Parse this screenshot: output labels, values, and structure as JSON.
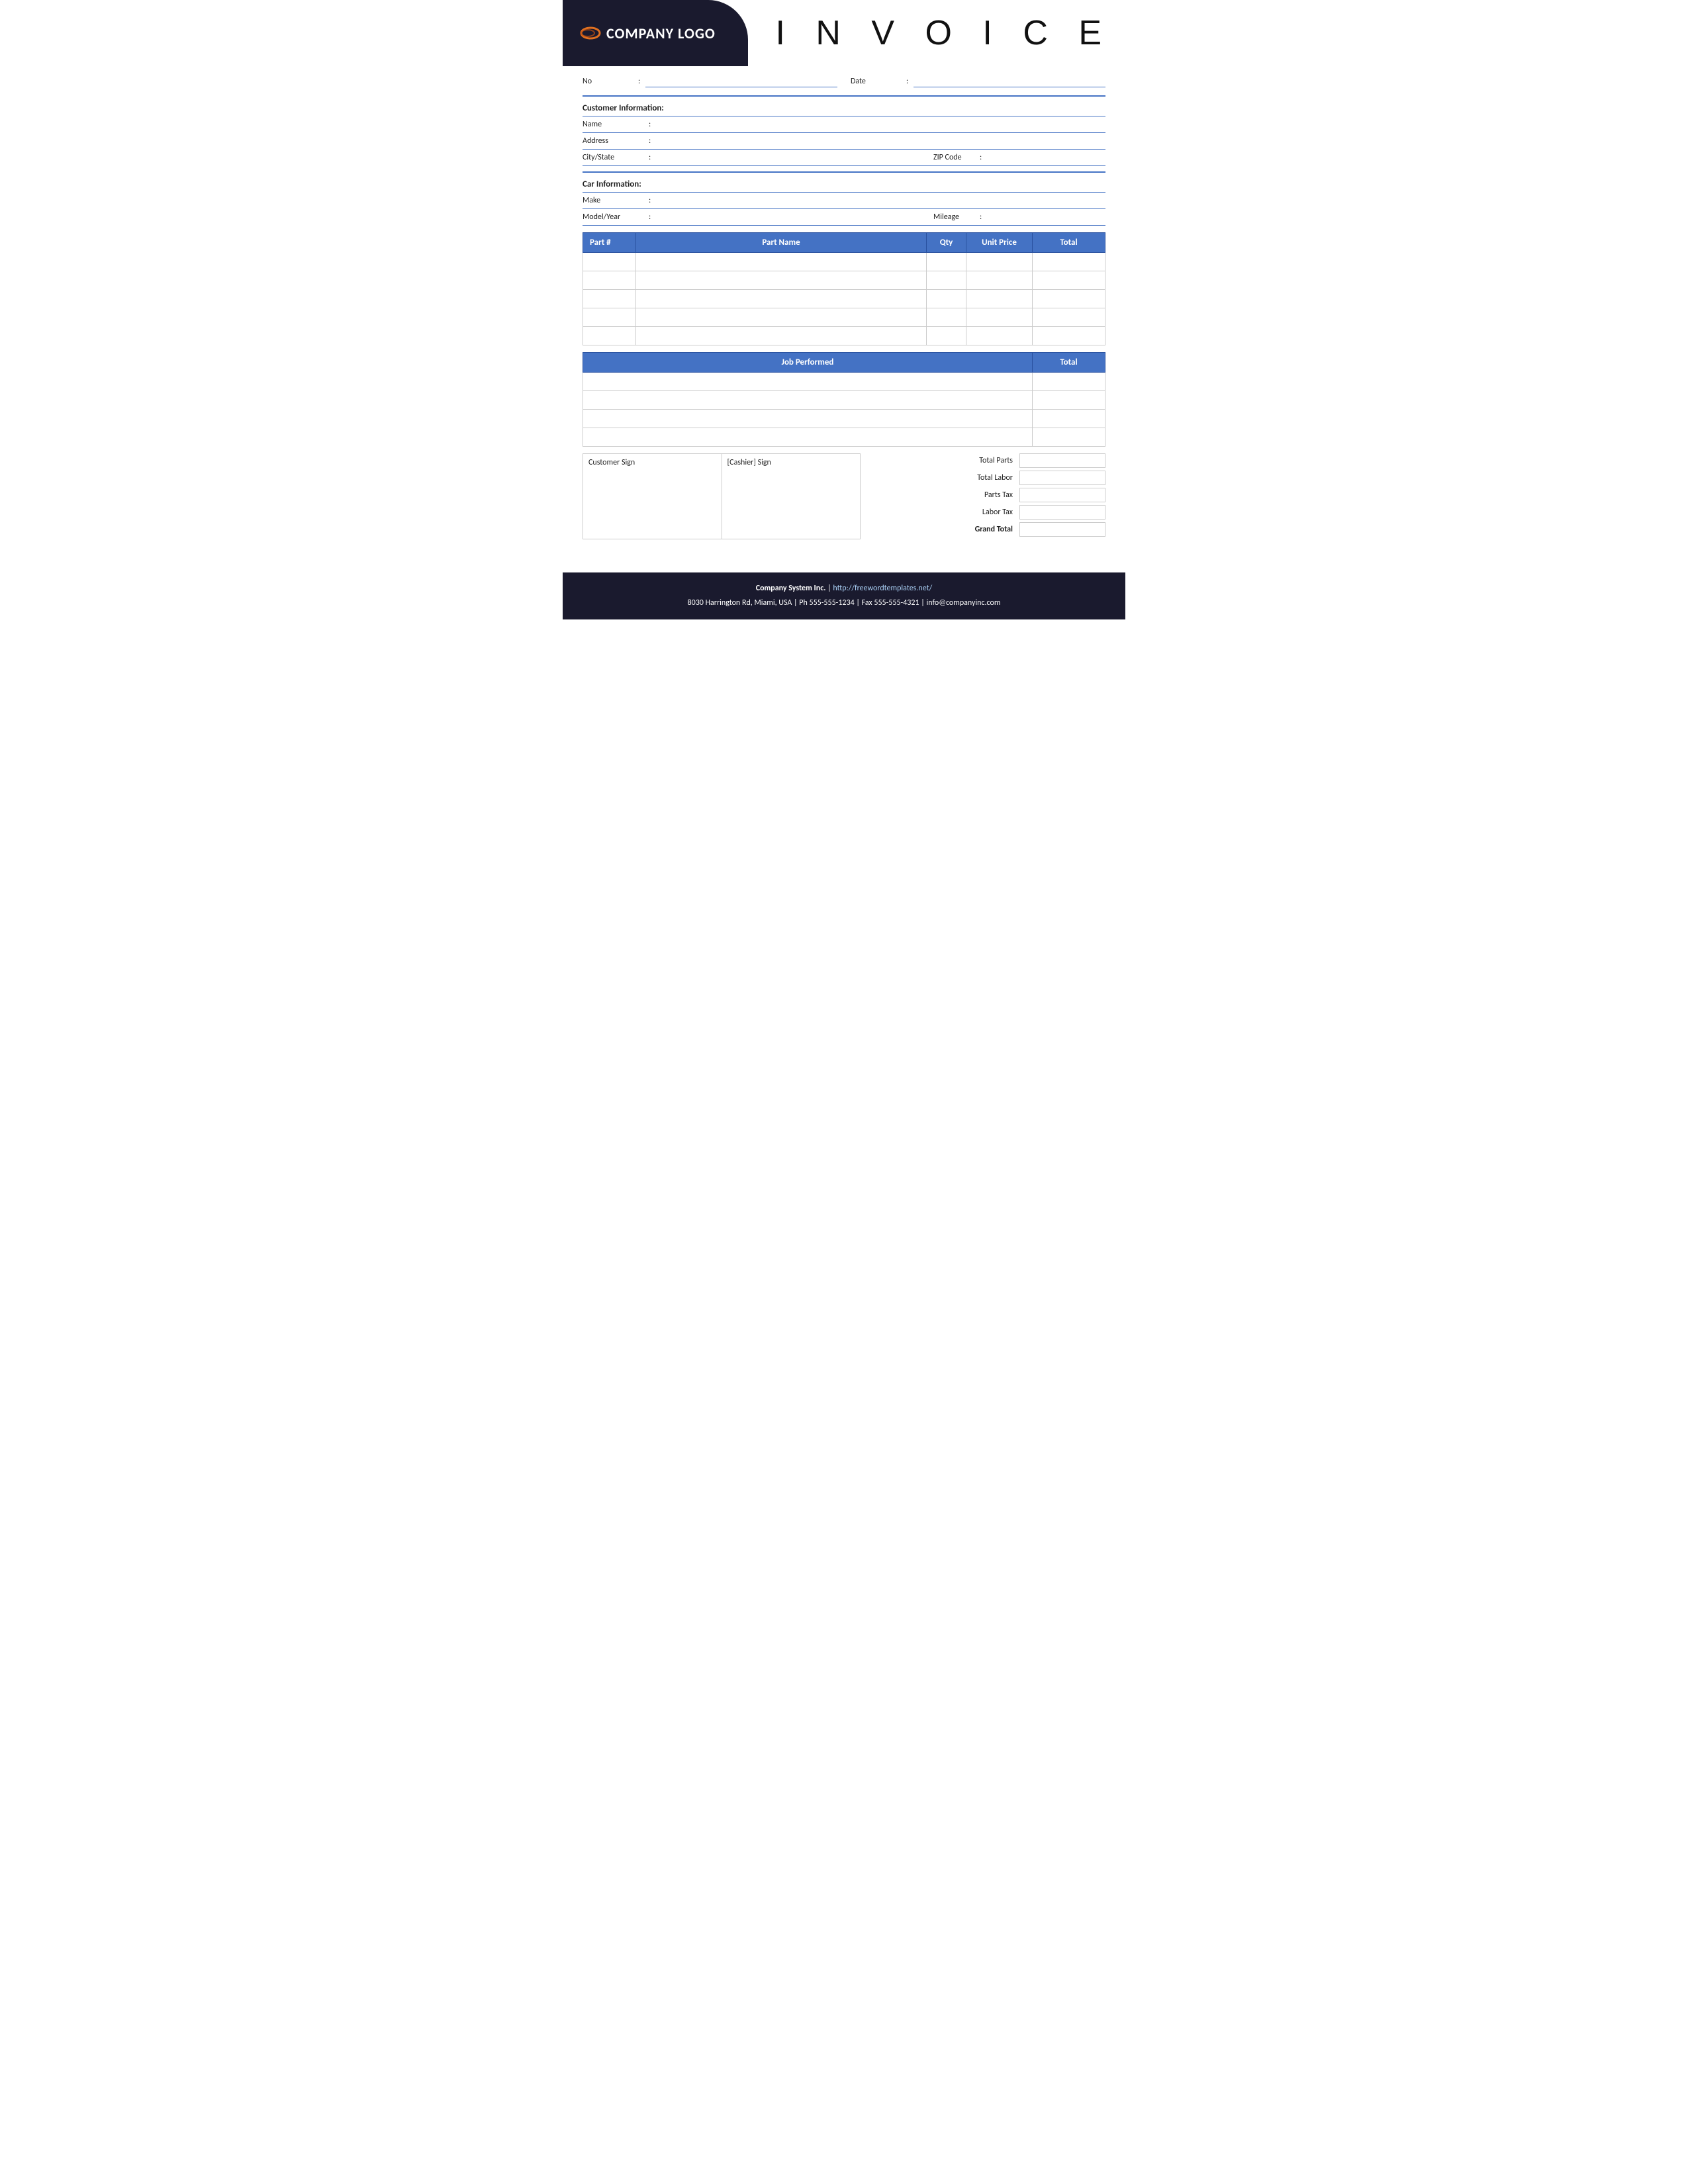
{
  "header": {
    "logo_text": "COMPANY LOGO",
    "invoice_title": "I N V O I C E"
  },
  "invoice_fields": {
    "no_label": "No",
    "colon": ":",
    "date_label": "Date"
  },
  "customer_info": {
    "section_title": "Customer Information:",
    "name_label": "Name",
    "address_label": "Address",
    "city_state_label": "City/State",
    "zip_code_label": "ZIP Code"
  },
  "car_info": {
    "section_title": "Car Information:",
    "make_label": "Make",
    "model_year_label": "Model/Year",
    "mileage_label": "Mileage"
  },
  "parts_table": {
    "headers": [
      "Part #",
      "Part Name",
      "Qty",
      "Unit Price",
      "Total"
    ],
    "rows": [
      {
        "part": "",
        "name": "",
        "qty": "",
        "unit_price": "",
        "total": ""
      },
      {
        "part": "",
        "name": "",
        "qty": "",
        "unit_price": "",
        "total": ""
      },
      {
        "part": "",
        "name": "",
        "qty": "",
        "unit_price": "",
        "total": ""
      },
      {
        "part": "",
        "name": "",
        "qty": "",
        "unit_price": "",
        "total": ""
      },
      {
        "part": "",
        "name": "",
        "qty": "",
        "unit_price": "",
        "total": ""
      }
    ]
  },
  "job_table": {
    "headers": [
      "Job Performed",
      "Total"
    ],
    "rows": [
      {
        "job": "",
        "total": ""
      },
      {
        "job": "",
        "total": ""
      },
      {
        "job": "",
        "total": ""
      },
      {
        "job": "",
        "total": ""
      }
    ]
  },
  "signatures": {
    "customer_sign_label": "Customer Sign",
    "cashier_sign_label": "[Cashier] Sign"
  },
  "totals": {
    "total_parts_label": "Total Parts",
    "total_labor_label": "Total Labor",
    "parts_tax_label": "Parts Tax",
    "labor_tax_label": "Labor Tax",
    "grand_total_label": "Grand Total"
  },
  "footer": {
    "company": "Company System Inc.",
    "separator": " | ",
    "website_label": "http://freewordtemplates.net/",
    "address": "8030 Harrington Rd, Miami, USA | Ph 555-555-1234 | Fax 555-555-4321 | info@companyinc.com"
  }
}
